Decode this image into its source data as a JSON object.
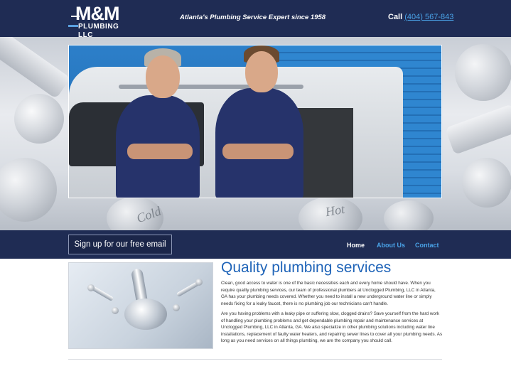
{
  "header": {
    "logo_main": "M&M",
    "logo_sub": "PLUMBING LLC",
    "tagline": "Atlanta's Plumbing Service Expert since 1958",
    "call_label": "Call",
    "phone": "(404) 567-843"
  },
  "hero": {
    "decor_text_1": "Cold",
    "decor_text_2": "Hot"
  },
  "nav": {
    "signup": "Sign up for our free email list",
    "items": [
      {
        "label": "Home",
        "color": "#ffffff"
      },
      {
        "label": "About Us",
        "color": "#4aa3e8"
      },
      {
        "label": "Contact",
        "color": "#4aa3e8"
      }
    ]
  },
  "content": {
    "heading": "Quality plumbing services",
    "paragraph_1": "Clean, good access to water is one of the basic necessities each and every home should have. When you require quality plumbing services, our team of professional plumbers at Unclogged Plumbing, LLC in Atlanta, GA has your plumbing needs covered. Whether you need to install a new underground water line or simply needs fixing for a leaky faucet, there is no plumbing job our technicians can't handle.",
    "paragraph_2": "Are you having problems with a leaky pipe or suffering slow, clogged drains? Save yourself from the hard work of handling your plumbing problems and get dependable plumbing repair and maintenance services at Unclogged Plumbing, LLC in Atlanta, GA. We also specialize in other plumbing solutions including water line installations, replacement of faulty water heaters, and repairing sewer lines to cover all your plumbing needs. As long as you need services on all things plumbing, we are the company you should call."
  },
  "colors": {
    "header_bg": "#1f2c54",
    "accent": "#1f64b8",
    "link": "#4aa3e8"
  }
}
